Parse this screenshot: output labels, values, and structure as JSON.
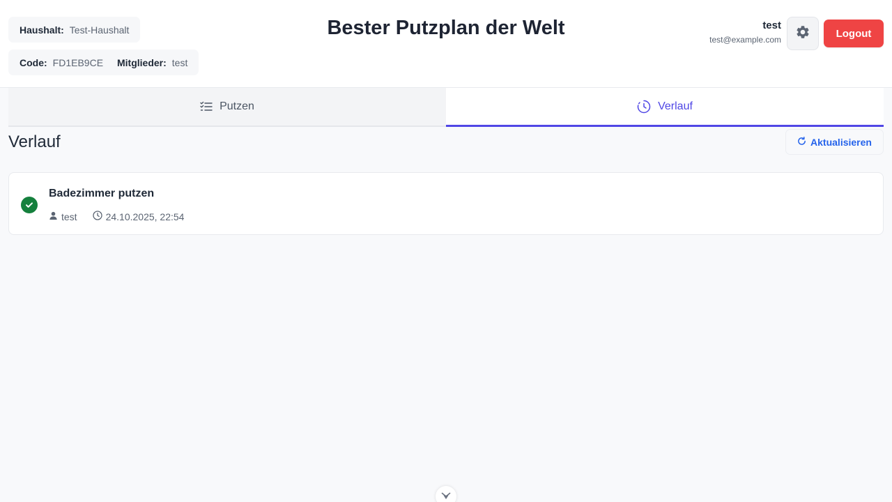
{
  "header": {
    "title": "Bester Putzplan der Welt",
    "household": {
      "label": "Haushalt:",
      "value": "Test-Haushalt"
    },
    "code": {
      "label": "Code:",
      "value": "FD1EB9CE"
    },
    "members": {
      "label": "Mitglieder:",
      "value": "test"
    },
    "user": {
      "name": "test",
      "email": "test@example.com"
    },
    "settings_icon": "gear-icon",
    "logout_label": "Logout"
  },
  "tabs": [
    {
      "label": "Putzen",
      "icon": "list-icon",
      "active": false
    },
    {
      "label": "Verlauf",
      "icon": "clock-icon",
      "active": true
    }
  ],
  "history": {
    "title": "Verlauf",
    "refresh_label": "Aktualisieren",
    "entries": [
      {
        "task": "Badezimmer putzen",
        "user": "test",
        "datetime": "24.10.2025, 22:54",
        "status": "done"
      }
    ]
  },
  "colors": {
    "accent": "#5046e5",
    "danger": "#ef4444",
    "success": "#15803d",
    "link": "#2563eb"
  }
}
